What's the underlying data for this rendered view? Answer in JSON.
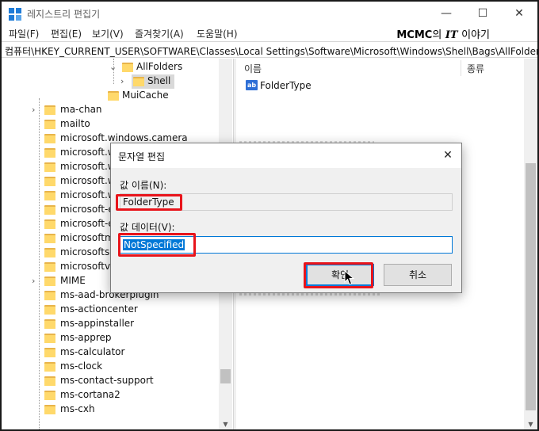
{
  "window": {
    "title": "레지스트리 편집기",
    "minimize_glyph": "—",
    "maximize_glyph": "☐",
    "close_glyph": "✕"
  },
  "menu": {
    "items": [
      "파일(F)",
      "편집(E)",
      "보기(V)",
      "즐겨찾기(A)",
      "도움말(H)"
    ]
  },
  "brand": {
    "main": "MCMC",
    "particle": "의",
    "it": "IT",
    "tail": "이야기"
  },
  "address": {
    "path": "컴퓨터\\HKEY_CURRENT_USER\\SOFTWARE\\Classes\\Local Settings\\Software\\Microsoft\\Windows\\Shell\\Bags\\AllFolders\\Shell"
  },
  "tree": {
    "top_items": [
      {
        "label": "AllFolders",
        "expanded": true
      },
      {
        "label": "Shell",
        "selected": true
      },
      {
        "label": "MuiCache"
      }
    ],
    "items": [
      "ma-chan",
      "mailto",
      "microsoft.windows.camera",
      "microsoft.w",
      "microsoft.w",
      "microsoft.w",
      "microsoft.w",
      "microsoft-e",
      "microsoft-e",
      "microsoftm",
      "microsoftso",
      "microsoftvid",
      "MIME",
      "ms-aad-brokerplugin",
      "ms-actioncenter",
      "ms-appinstaller",
      "ms-apprep",
      "ms-calculator",
      "ms-clock",
      "ms-contact-support",
      "ms-cortana2",
      "ms-cxh"
    ]
  },
  "values_pane": {
    "col_name": "이름",
    "col_type": "종류",
    "rows": [
      {
        "icon": "ab",
        "name": "FolderType"
      }
    ]
  },
  "dialog": {
    "title": "문자열 편집",
    "close_glyph": "✕",
    "name_label": "값 이름(N):",
    "name_value": "FolderType",
    "data_label": "값 데이터(V):",
    "data_value": "NotSpecified",
    "ok_label": "확인",
    "cancel_label": "취소"
  },
  "colors": {
    "highlight": "#e8141b",
    "accent": "#0078d7",
    "folder": "#ffd96b"
  }
}
